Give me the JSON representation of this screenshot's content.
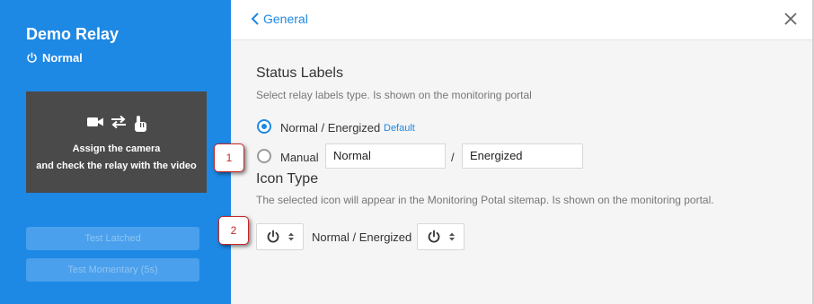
{
  "sidebar": {
    "title": "Demo Relay",
    "status": "Normal",
    "camera_line1": "Assign the camera",
    "camera_line2": "and check the relay with the video",
    "test_latched": "Test Latched",
    "test_momentary": "Test Momentary (5s)"
  },
  "header": {
    "back_label": "General"
  },
  "status_labels": {
    "title": "Status Labels",
    "description": "Select relay labels type. Is shown on the monitoring portal",
    "option_default_label": "Normal / Energized",
    "default_badge": "Default",
    "option_manual_label": "Manual",
    "manual_normal_value": "Normal",
    "separator": "/",
    "manual_energized_value": "Energized",
    "selected": "default"
  },
  "icon_type": {
    "title": "Icon Type",
    "description": "The selected icon will appear in the Monitoring Potal sitemap. Is shown on the monitoring portal.",
    "normal_energized_label": "Normal / Energized",
    "normal_icon": "power-icon",
    "energized_icon": "power-icon"
  },
  "callouts": {
    "first": "1",
    "second": "2"
  },
  "colors": {
    "accent": "#1e88e5",
    "callout": "#c62828"
  }
}
